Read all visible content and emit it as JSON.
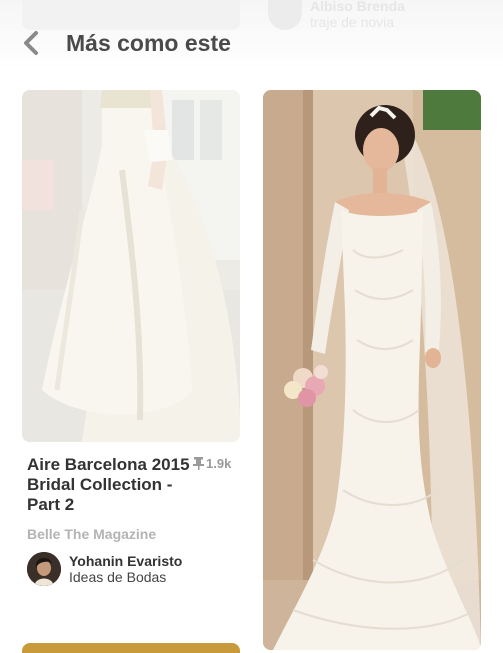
{
  "header": {
    "title": "Más como este",
    "ghost_pin_name": "Albiso Brenda",
    "ghost_pin_board": "traje de novia"
  },
  "pins": [
    {
      "title": "Aire Barcelona 2015 Bridal Collection - Part 2",
      "repins": "1.9k",
      "source": "Belle The Magazine",
      "pinner_name": "Yohanin Evaristo",
      "pinner_board": "Ideas de Bodas"
    },
    {
      "title": ""
    }
  ],
  "colors": {
    "title_text": "#333333",
    "muted_text": "#b4b4b4",
    "repin_icon": "#9a9a9a"
  },
  "icons": {
    "back": "chevron-left-icon",
    "repin": "pin-icon"
  }
}
